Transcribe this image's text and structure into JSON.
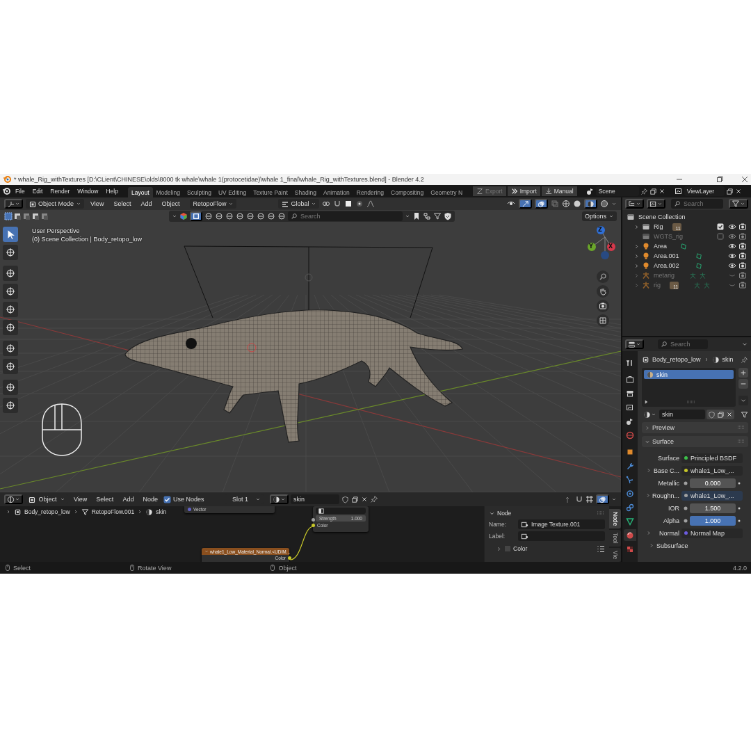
{
  "title_bar": {
    "title": "* whale_Rig_withTextures [D:\\CLient\\CHINESE\\olds\\8000 tk whale\\whale 1(protocetidae)\\whale 1_final\\whale_Rig_withTextures.blend] - Blender 4.2"
  },
  "top_bar": {
    "menus": [
      "File",
      "Edit",
      "Render",
      "Window",
      "Help"
    ],
    "workspaces": [
      {
        "label": "Layout",
        "selected": true
      },
      {
        "label": "Modeling",
        "selected": false
      },
      {
        "label": "Sculpting",
        "selected": false
      },
      {
        "label": "UV Editing",
        "selected": false
      },
      {
        "label": "Texture Paint",
        "selected": false
      },
      {
        "label": "Shading",
        "selected": false
      },
      {
        "label": "Animation",
        "selected": false
      },
      {
        "label": "Rendering",
        "selected": false
      },
      {
        "label": "Compositing",
        "selected": false
      },
      {
        "label": "Geometry N",
        "selected": false
      }
    ],
    "addon_buttons": [
      {
        "label": "Export",
        "disabled": true
      },
      {
        "label": "Import",
        "disabled": false
      },
      {
        "label": "Manual",
        "disabled": false
      }
    ],
    "scene": "Scene",
    "view_layer": "ViewLayer"
  },
  "viewport": {
    "mode": "Object Mode",
    "menus": [
      "View",
      "Select",
      "Add",
      "Object"
    ],
    "addon_menu": "RetopoFlow",
    "orientation": "Global",
    "search": {
      "placeholder": "Search"
    },
    "options": "Options",
    "overlay_lines": [
      "User Perspective",
      "(0) Scene Collection | Body_retopo_low"
    ],
    "gizmo_axes": [
      "Z",
      "Y",
      "X"
    ]
  },
  "node_editor": {
    "object_type": "Object",
    "menus": [
      "View",
      "Select",
      "Add",
      "Node"
    ],
    "use_nodes": {
      "label": "Use Nodes",
      "checked": true
    },
    "slot": "Slot 1",
    "material": "skin",
    "breadcrumb": [
      "Body_retopo_low",
      "RetopoFlow.001",
      "skin"
    ],
    "vector_node": {
      "socket": "Vector"
    },
    "normal_map_node": {
      "strength_label": "Strength",
      "strength": "1.000",
      "input": "Color"
    },
    "texture_node": {
      "title": "whale1_Low_Material_Normal.<UDIM...",
      "output": "Color"
    },
    "sidebar": {
      "panel": "Node",
      "name_label": "Name:",
      "name": "Image Texture.001",
      "label_label": "Label:",
      "subpanel": "Color"
    },
    "tabs": [
      {
        "label": "Node",
        "selected": true
      },
      {
        "label": "Tool",
        "selected": false
      },
      {
        "label": "Vie",
        "selected": false
      }
    ]
  },
  "outliner": {
    "search": {
      "placeholder": "Search"
    },
    "tree": [
      {
        "label": "Scene Collection",
        "kind": "scene_collection",
        "children": [
          {
            "label": "Rig",
            "kind": "collection",
            "expanded": false,
            "badge": "11",
            "checked": true,
            "hidden": false
          },
          {
            "label": "WGTS_rig",
            "kind": "collection",
            "checked": false,
            "hidden": false
          },
          {
            "label": "Area",
            "kind": "light",
            "expanded": false,
            "hidden": false
          },
          {
            "label": "Area.001",
            "kind": "light",
            "expanded": false,
            "hidden": false
          },
          {
            "label": "Area.002",
            "kind": "light",
            "expanded": false,
            "hidden": false
          },
          {
            "label": "metarig",
            "kind": "armature",
            "expanded": false,
            "hidden": true
          },
          {
            "label": "rig",
            "kind": "armature",
            "expanded": false,
            "badge": "11",
            "hidden": true
          }
        ]
      }
    ]
  },
  "properties": {
    "search": {
      "placeholder": "Search"
    },
    "tabs": [
      {
        "kind": "tool",
        "selected": false
      },
      {
        "kind": "render",
        "selected": false
      },
      {
        "kind": "output",
        "selected": false
      },
      {
        "kind": "view_layer",
        "selected": false
      },
      {
        "kind": "scene",
        "selected": false
      },
      {
        "kind": "world",
        "selected": false
      },
      {
        "kind": "object",
        "selected": false
      },
      {
        "kind": "modifiers",
        "selected": false
      },
      {
        "kind": "particles",
        "selected": false
      },
      {
        "kind": "physics",
        "selected": false
      },
      {
        "kind": "constraints",
        "selected": false
      },
      {
        "kind": "data",
        "selected": false
      },
      {
        "kind": "material",
        "selected": true
      },
      {
        "kind": "texture",
        "selected": false
      }
    ],
    "breadcrumb": [
      "Body_retopo_low",
      "skin"
    ],
    "slots": [
      {
        "label": "skin",
        "selected": true
      }
    ],
    "material": "skin",
    "panels": [
      {
        "title": "Preview",
        "expanded": false
      },
      {
        "title": "Surface",
        "expanded": true,
        "rows": [
          {
            "kind": "link",
            "label": "Surface",
            "value": "Principled BSDF",
            "color": "#3cc24a",
            "expandable": false
          },
          {
            "kind": "link",
            "label": "Base C...",
            "value": "whale1_Low_...",
            "color": "#c7c729",
            "expandable": true
          },
          {
            "kind": "slider",
            "label": "Metallic",
            "value": "0.000",
            "level": 0
          },
          {
            "kind": "link",
            "label": "Roughn...",
            "value": "whale1_Low_...",
            "color": "#a1a1a1",
            "expandable": true
          },
          {
            "kind": "number",
            "label": "IOR",
            "value": "1.500"
          },
          {
            "kind": "slider",
            "label": "Alpha",
            "value": "1.000",
            "level": 1
          },
          {
            "kind": "link",
            "label": "Normal",
            "value": "Normal Map",
            "color": "#6c5ce0",
            "expandable": true
          },
          {
            "kind": "subpanel",
            "label": "Subsurface"
          }
        ]
      }
    ]
  },
  "status_bar": {
    "hints": [
      "Select",
      "Rotate View",
      "Object"
    ],
    "version": "4.2.0"
  }
}
